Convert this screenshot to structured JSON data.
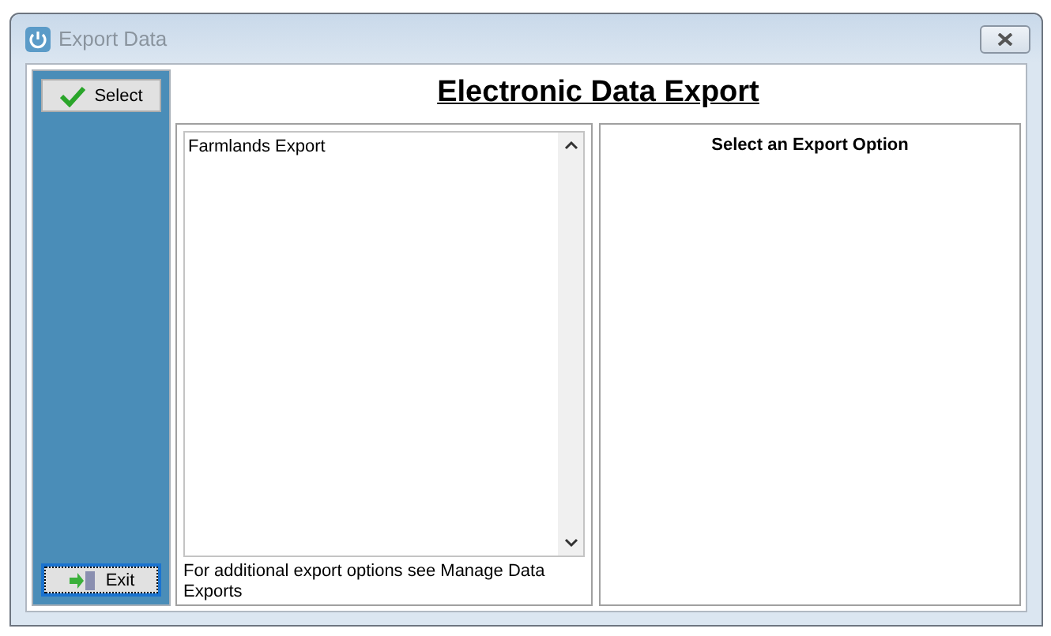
{
  "window": {
    "title": "Export Data"
  },
  "sidebar": {
    "buttons": [
      {
        "label": "Select",
        "kind": "select",
        "focused": false
      },
      {
        "label": "Exit",
        "kind": "exit",
        "focused": true
      }
    ]
  },
  "heading": "Electronic Data Export",
  "export_list": {
    "items": [
      {
        "label": "Farmlands Export",
        "selected": false
      }
    ],
    "note": "For additional export options see Manage Data Exports"
  },
  "options_panel": {
    "title": "Select an Export Option"
  }
}
